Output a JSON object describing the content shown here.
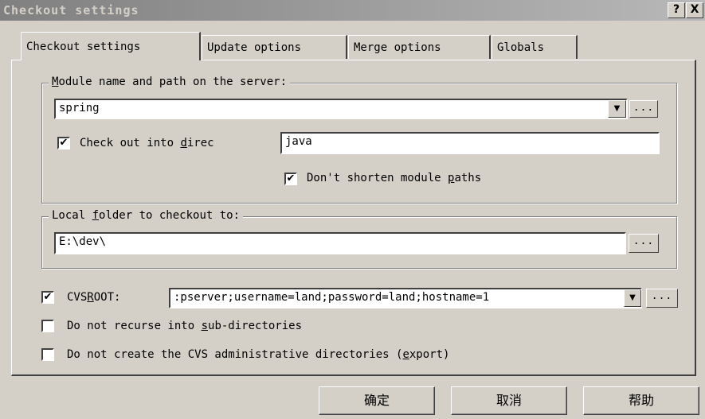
{
  "window": {
    "title": "Checkout settings",
    "help_glyph": "?",
    "close_glyph": "X"
  },
  "tabs": [
    {
      "label": "Checkout settings"
    },
    {
      "label": "Update options"
    },
    {
      "label": "Merge options"
    },
    {
      "label": "Globals"
    }
  ],
  "module_group": {
    "legend_hotkey": "M",
    "legend_rest": "odule name and path on the server:",
    "module_value": "spring",
    "dropdown_glyph": "▼",
    "browse_label": "...",
    "checkout_into": {
      "checked": true,
      "check_glyph": "✔",
      "label_before": "Check out into ",
      "label_hotkey": "d",
      "label_after": "irec",
      "value": "java"
    },
    "dont_shorten": {
      "checked": true,
      "check_glyph": "✔",
      "label_before": "Don't shorten module ",
      "label_hotkey": "p",
      "label_after": "aths"
    }
  },
  "local_group": {
    "legend_before": "Local ",
    "legend_hotkey": "f",
    "legend_after": "older to checkout to:",
    "value": "E:\\dev\\",
    "browse_label": "..."
  },
  "cvsroot": {
    "checked": true,
    "check_glyph": "✔",
    "label_before": "CVS",
    "label_hotkey": "R",
    "label_after": "OOT:",
    "value": ":pserver;username=land;password=land;hostname=1",
    "dropdown_glyph": "▼",
    "browse_label": "..."
  },
  "options": [
    {
      "checked": false,
      "label_before": "Do not recurse into ",
      "label_hotkey": "s",
      "label_after": "ub-directories"
    },
    {
      "checked": false,
      "label_before": "Do not create the CVS administrative directories (",
      "label_hotkey": "e",
      "label_after": "xport)"
    }
  ],
  "buttons": {
    "ok": "确定",
    "cancel": "取消",
    "help": "帮助"
  }
}
